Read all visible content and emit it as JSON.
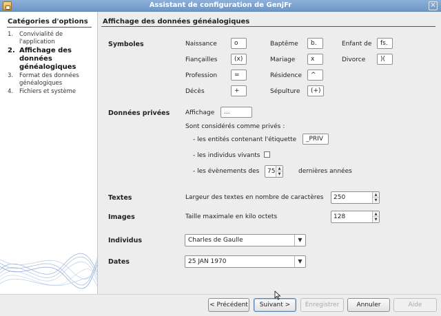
{
  "window": {
    "title": "Assistant de configuration de GenjFr",
    "close_glyph": "×"
  },
  "sidebar": {
    "title": "Catégories d'options",
    "steps": [
      {
        "num": "1.",
        "label": "Convivialité de l'application"
      },
      {
        "num": "2.",
        "label": "Affichage des données généalogiques"
      },
      {
        "num": "3.",
        "label": "Format des données généalogiques"
      },
      {
        "num": "4.",
        "label": "Fichiers et système"
      }
    ]
  },
  "main": {
    "title": "Affichage des données généalogiques",
    "symboles": {
      "label": "Symboles",
      "items": [
        {
          "label": "Naissance",
          "value": "o"
        },
        {
          "label": "Baptême",
          "value": "b."
        },
        {
          "label": "Enfant de",
          "value": "fs."
        },
        {
          "label": "Fiançailles",
          "value": "(x)"
        },
        {
          "label": "Mariage",
          "value": "x"
        },
        {
          "label": "Divorce",
          "value": ")("
        },
        {
          "label": "Profession",
          "value": "="
        },
        {
          "label": "Résidence",
          "value": "^"
        },
        {
          "label": "Décès",
          "value": "+"
        },
        {
          "label": "Sépulture",
          "value": "(+)"
        }
      ]
    },
    "prives": {
      "label": "Données privées",
      "affichage_label": "Affichage",
      "affichage_value": "...",
      "intro": "Sont considérés comme privés :",
      "etiquette_label": "- les entités contenant l'étiquette",
      "etiquette_value": "_PRIV",
      "vivants_label": "- les individus vivants",
      "vivants_checked": false,
      "evenements_label": "- les évènements des",
      "evenements_value": "75",
      "evenements_suffix": "dernières années"
    },
    "textes": {
      "label": "Textes",
      "description": "Largeur des textes en nombre de caractères",
      "value": "250"
    },
    "images": {
      "label": "Images",
      "description": "Taille maximale en kilo octets",
      "value": "128"
    },
    "individus": {
      "label": "Individus",
      "value": "Charles de Gaulle"
    },
    "dates": {
      "label": "Dates",
      "value": "25 JAN 1970"
    }
  },
  "buttons": {
    "previous": "< Précédent",
    "next": "Suivant >",
    "save": "Enregistrer",
    "cancel": "Annuler",
    "help": "Aide"
  },
  "colors": {
    "titlebar": "#7ea3d0",
    "accent_default_button": "#5a7fb0"
  }
}
